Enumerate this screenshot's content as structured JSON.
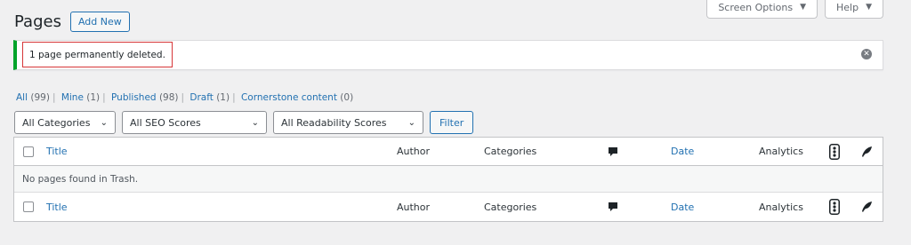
{
  "screen_meta": {
    "screen_options": "Screen Options",
    "help": "Help",
    "caret": "▼"
  },
  "header": {
    "title": "Pages",
    "add_new": "Add New"
  },
  "notice": {
    "message": "1 page permanently deleted.",
    "dismiss_glyph": "✕"
  },
  "views": [
    {
      "label": "All",
      "count": "(99)"
    },
    {
      "label": "Mine",
      "count": "(1)"
    },
    {
      "label": "Published",
      "count": "(98)"
    },
    {
      "label": "Draft",
      "count": "(1)"
    },
    {
      "label": "Cornerstone content",
      "count": "(0)"
    }
  ],
  "views_separator": "|",
  "filters": {
    "categories": "All Categories",
    "seo": "All SEO Scores",
    "readability": "All Readability Scores",
    "chevron": "⌄",
    "button": "Filter"
  },
  "table": {
    "columns": {
      "title": "Title",
      "author": "Author",
      "categories": "Categories",
      "comments_icon": "comment-icon",
      "date": "Date",
      "analytics": "Analytics",
      "readability_icon": "traffic-light-icon",
      "seo_icon": "feather-icon"
    },
    "empty_message": "No pages found in Trash."
  },
  "colors": {
    "accent": "#2271b1",
    "success": "#00a32a",
    "highlight": "#d63638"
  }
}
